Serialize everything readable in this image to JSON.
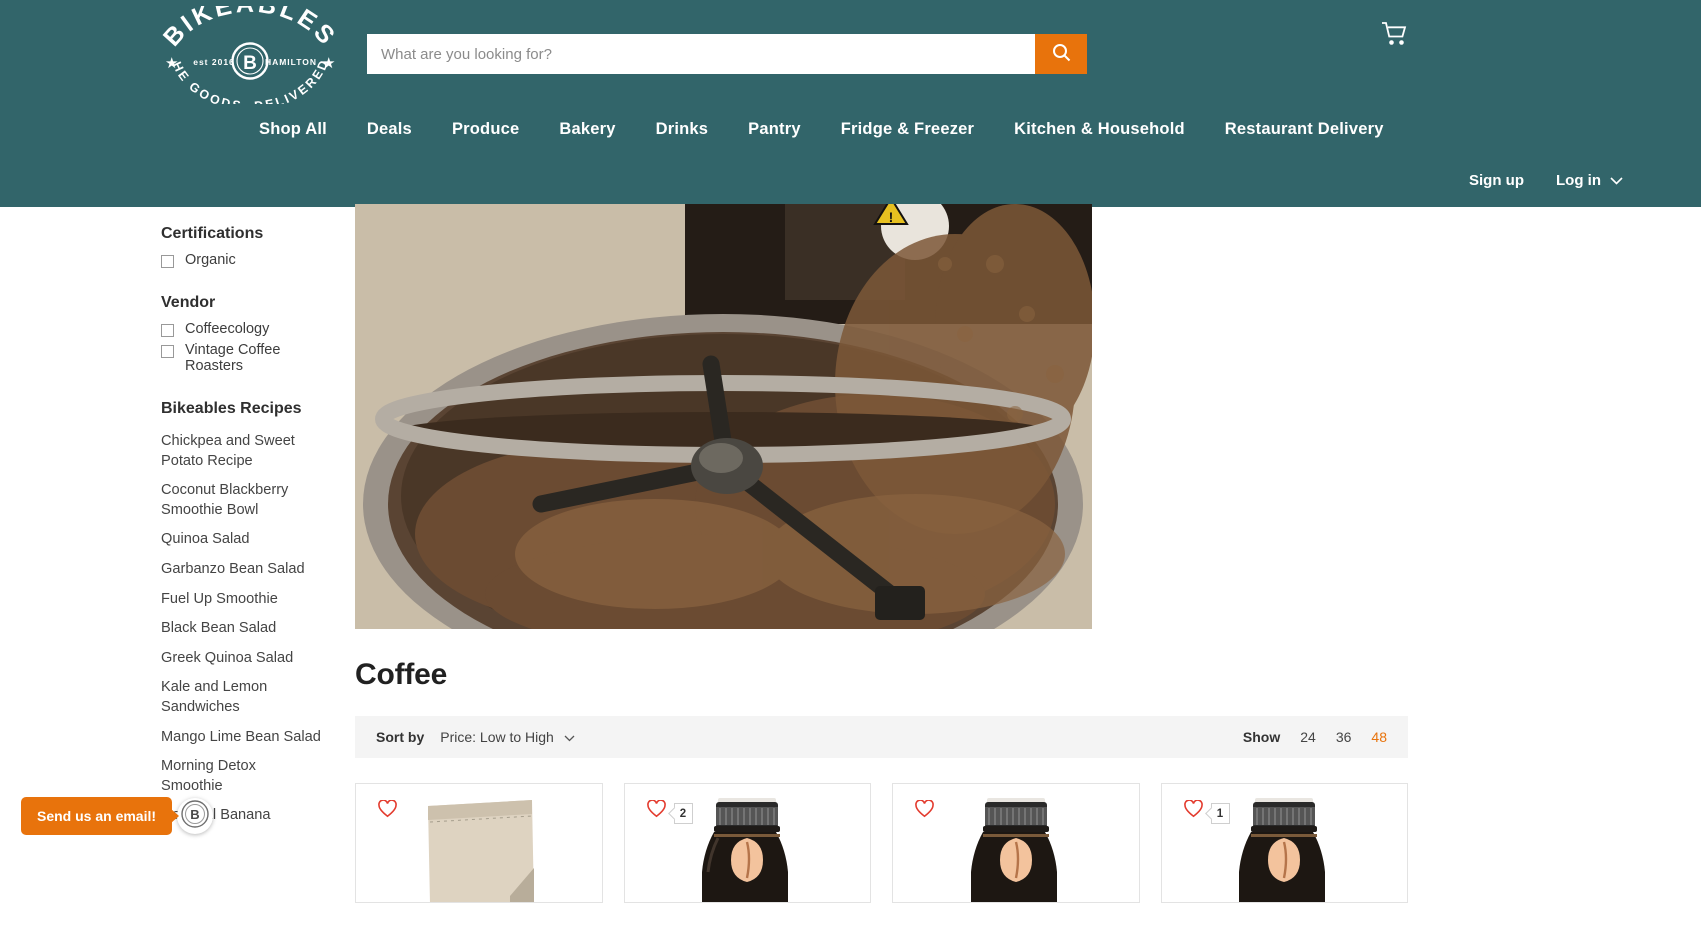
{
  "brand": {
    "name": "BIKEABLES",
    "est": "est 2016",
    "city": "HAMILTON",
    "monogram": "B",
    "tagline": "THE GOODS. DELIVERED.",
    "accent_color": "#e8730c",
    "header_color": "#32656a"
  },
  "search": {
    "placeholder": "What are you looking for?",
    "value": "",
    "icon": "search-icon"
  },
  "cart": {
    "icon": "shopping-cart-icon"
  },
  "nav": {
    "items": [
      {
        "label": "Shop All"
      },
      {
        "label": "Deals"
      },
      {
        "label": "Produce"
      },
      {
        "label": "Bakery"
      },
      {
        "label": "Drinks"
      },
      {
        "label": "Pantry"
      },
      {
        "label": "Fridge & Freezer"
      },
      {
        "label": "Kitchen & Household"
      },
      {
        "label": "Restaurant Delivery"
      }
    ]
  },
  "account": {
    "signup_label": "Sign up",
    "login_label": "Log in",
    "login_chevron": "chevron-down-icon"
  },
  "sidebar": {
    "filters": [
      {
        "title": "Certifications",
        "options": [
          {
            "label": "Organic",
            "checked": false
          }
        ]
      },
      {
        "title": "Vendor",
        "options": [
          {
            "label": "Coffeecology",
            "checked": false
          },
          {
            "label": "Vintage Coffee Roasters",
            "checked": false
          }
        ]
      }
    ],
    "recipes_title": "Bikeables Recipes",
    "recipes": [
      {
        "label": "Chickpea and Sweet Potato Recipe"
      },
      {
        "label": "Coconut Blackberry Smoothie Bowl"
      },
      {
        "label": "Quinoa Salad"
      },
      {
        "label": "Garbanzo Bean Salad"
      },
      {
        "label": "Fuel Up Smoothie"
      },
      {
        "label": "Black Bean Salad"
      },
      {
        "label": "Greek Quinoa Salad"
      },
      {
        "label": "Kale and Lemon Sandwiches"
      },
      {
        "label": "Mango Lime Bean Salad"
      },
      {
        "label": "Morning Detox Smoothie"
      },
      {
        "label": "Oatmeal Banana"
      }
    ]
  },
  "main": {
    "hero_alt": "coffee-roaster-beans-photo",
    "title": "Coffee",
    "sort": {
      "label": "Sort by",
      "value": "Price: Low to High",
      "chevron": "chevron-down-icon"
    },
    "show": {
      "label": "Show",
      "options": [
        {
          "label": "24",
          "active": false
        },
        {
          "label": "36",
          "active": false
        },
        {
          "label": "48",
          "active": true
        }
      ]
    },
    "products": [
      {
        "name": "coffee-bag-product",
        "wishlist_icon": "heart-icon",
        "count": "",
        "image": "bag"
      },
      {
        "name": "cold-brew-bottle-product",
        "wishlist_icon": "heart-icon",
        "count": "2",
        "image": "bottle"
      },
      {
        "name": "cold-brew-bottle-product",
        "wishlist_icon": "heart-icon",
        "count": "",
        "image": "bottle"
      },
      {
        "name": "cold-brew-bottle-product",
        "wishlist_icon": "heart-icon",
        "count": "1",
        "image": "bottle"
      }
    ]
  },
  "chat": {
    "bubble_text": "Send us an email!",
    "avatar_icon": "bikeables-monogram-icon"
  }
}
